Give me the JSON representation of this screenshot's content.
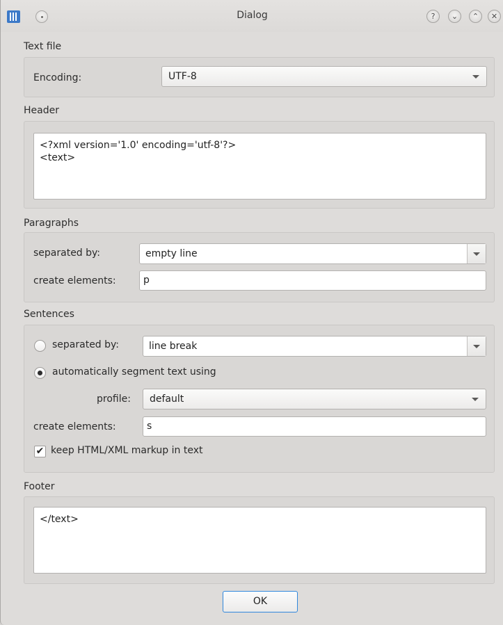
{
  "window": {
    "title": "Dialog",
    "buttons": {
      "help": "?",
      "minimize": "⌄",
      "maximize": "⌃",
      "close": "✕"
    }
  },
  "text_file": {
    "title": "Text file",
    "encoding_label": "Encoding:",
    "encoding_value": "UTF-8"
  },
  "header": {
    "title": "Header",
    "value": "<?xml version='1.0' encoding='utf-8'?>\n<text>"
  },
  "paragraphs": {
    "title": "Paragraphs",
    "separated_label": "separated by:",
    "separated_value": "empty line",
    "elements_label": "create elements:",
    "elements_value": "p"
  },
  "sentences": {
    "title": "Sentences",
    "separated_label": "separated by:",
    "separated_value": "line break",
    "separated_selected": false,
    "auto_label": "automatically segment text using",
    "auto_selected": true,
    "profile_label": "profile:",
    "profile_value": "default",
    "elements_label": "create elements:",
    "elements_value": "s",
    "keep_markup_label": "keep HTML/XML markup in text",
    "keep_markup_checked": true
  },
  "footer": {
    "title": "Footer",
    "value": "</text>"
  },
  "ok_label": "OK",
  "colors": {
    "focus_border": "#2f87dd",
    "app_icon": "#3c79c8"
  }
}
